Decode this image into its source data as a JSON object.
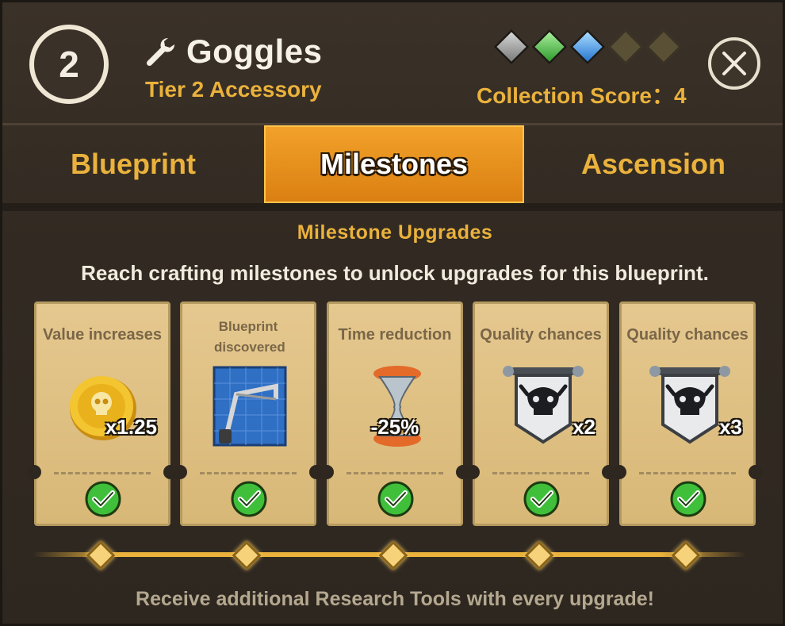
{
  "header": {
    "tier_number": "2",
    "item_name": "Goggles",
    "item_subtitle": "Tier 2 Accessory",
    "collection_score": "Collection Score：4",
    "gems": [
      "silver",
      "green",
      "blue",
      "empty",
      "empty"
    ],
    "close_icon": "close-x-icon"
  },
  "tabs": [
    {
      "label": "Blueprint",
      "active": false
    },
    {
      "label": "Milestones",
      "active": true
    },
    {
      "label": "Ascension",
      "active": false
    }
  ],
  "section": {
    "title": "Milestone Upgrades",
    "description": "Reach crafting milestones to unlock upgrades for this blueprint."
  },
  "milestones": [
    {
      "label": "Value increases",
      "icon": "gold-coin-icon",
      "badge": "x1.25",
      "completed": true
    },
    {
      "label": "Blueprint discovered",
      "icon": "blueprint-hacksaw-icon",
      "badge": "",
      "completed": true
    },
    {
      "label": "Time reduction",
      "icon": "hourglass-icon",
      "badge": "-25%",
      "completed": true
    },
    {
      "label": "Quality chances",
      "icon": "skull-banner-icon",
      "badge": "x2",
      "completed": true
    },
    {
      "label": "Quality chances",
      "icon": "skull-banner-icon",
      "badge": "x3",
      "completed": true
    }
  ],
  "footer": "Receive additional Research Tools with every upgrade!",
  "colors": {
    "accent": "#eab23c",
    "active_tab": "#e69219",
    "card": "#dfc184",
    "check_green": "#3fbf3a"
  }
}
